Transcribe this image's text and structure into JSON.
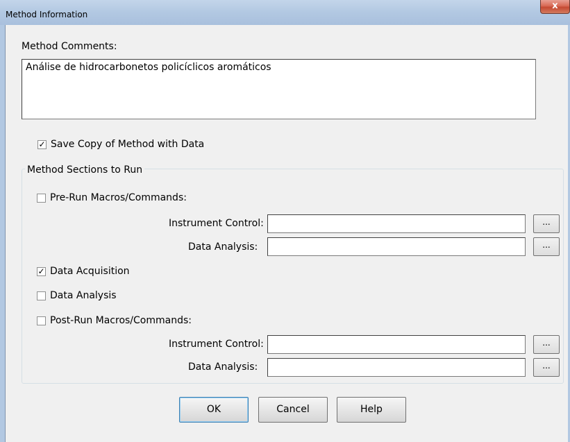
{
  "window": {
    "title": "Method Information",
    "close_glyph": "x"
  },
  "comments": {
    "label": "Method Comments:",
    "value": "Análise de hidrocarbonetos policíclicos aromáticos"
  },
  "save_copy": {
    "label": "Save Copy of Method with Data",
    "checked": true
  },
  "sections": {
    "group_label": "Method Sections to Run",
    "pre_run": {
      "label": "Pre-Run Macros/Commands:",
      "checked": false,
      "instrument_control_label": "Instrument Control:",
      "instrument_control_value": "",
      "data_analysis_label": "Data Analysis:",
      "data_analysis_value": "",
      "browse_label": "..."
    },
    "data_acquisition": {
      "label": "Data Acquisition",
      "checked": true
    },
    "data_analysis": {
      "label": "Data Analysis",
      "checked": false
    },
    "post_run": {
      "label": "Post-Run Macros/Commands:",
      "checked": false,
      "instrument_control_label": "Instrument Control:",
      "instrument_control_value": "",
      "data_analysis_label": "Data Analysis:",
      "data_analysis_value": "",
      "browse_label": "..."
    }
  },
  "buttons": {
    "ok": "OK",
    "cancel": "Cancel",
    "help": "Help"
  },
  "colors": {
    "titlebar": "#b2c8e2",
    "close_button": "#c54a32",
    "dialog_background": "#f0f0f0"
  },
  "check_glyph": "✓"
}
